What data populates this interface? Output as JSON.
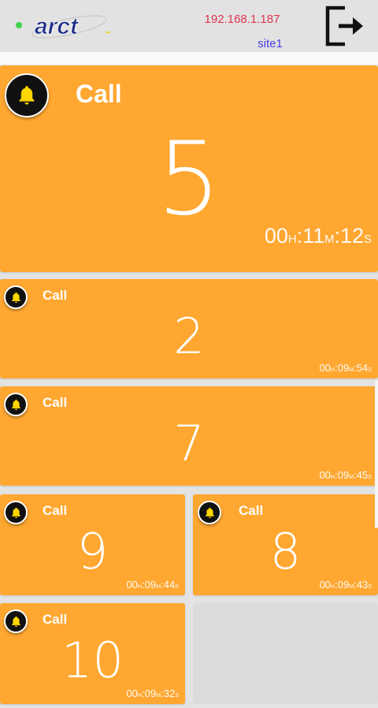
{
  "header": {
    "logo_text": "arct",
    "ip_address": "192.168.1.187",
    "site_name": "site1",
    "status_color": "#3fd24a",
    "logout_icon": "logout-icon"
  },
  "colors": {
    "card": "#ffa730",
    "empty": "#dcdcdc",
    "background": "#e3e3e3"
  },
  "calls": [
    {
      "label": "Call",
      "number": "5",
      "h": "00",
      "m": "11",
      "s": "12",
      "h_unit": "H",
      "m_unit": "M",
      "s_unit": "S"
    },
    {
      "label": "Call",
      "number": "2",
      "h": "00",
      "m": "09",
      "s": "54",
      "h_unit": "H",
      "m_unit": "M",
      "s_unit": "S"
    },
    {
      "label": "Call",
      "number": "7",
      "h": "00",
      "m": "09",
      "s": "45",
      "h_unit": "H",
      "m_unit": "M",
      "s_unit": "S"
    },
    {
      "label": "Call",
      "number": "9",
      "h": "00",
      "m": "09",
      "s": "44",
      "h_unit": "H",
      "m_unit": "M",
      "s_unit": "S"
    },
    {
      "label": "Call",
      "number": "8",
      "h": "00",
      "m": "09",
      "s": "43",
      "h_unit": "H",
      "m_unit": "M",
      "s_unit": "S"
    },
    {
      "label": "Call",
      "number": "10",
      "h": "00",
      "m": "09",
      "s": "32",
      "h_unit": "H",
      "m_unit": "M",
      "s_unit": "S"
    }
  ]
}
